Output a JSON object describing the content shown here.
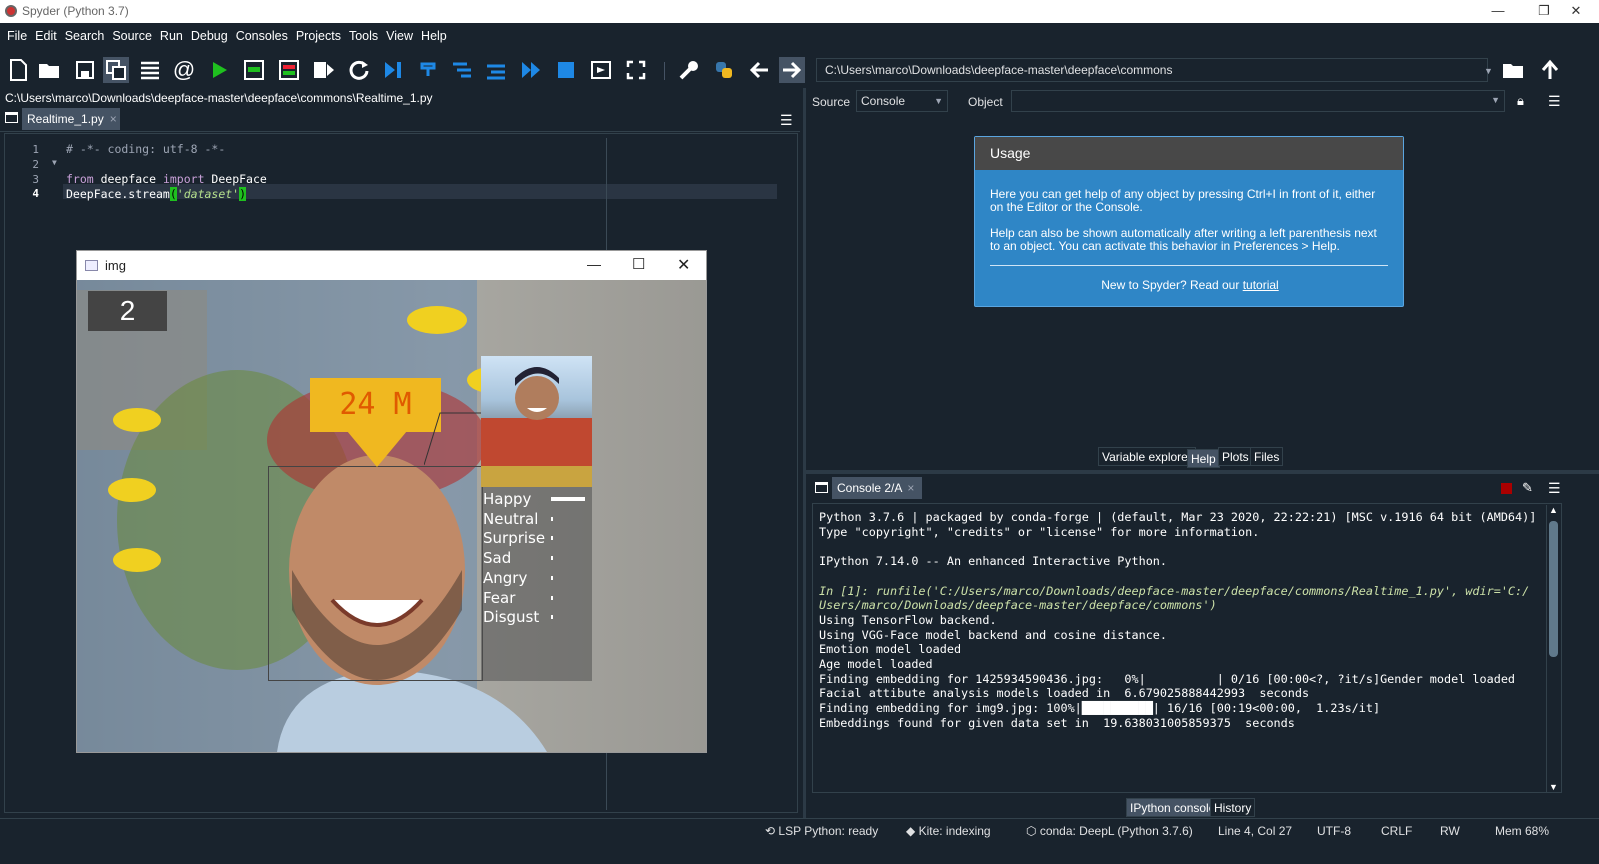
{
  "window": {
    "title": "Spyder (Python 3.7)",
    "min": "—",
    "max": "❐",
    "close": "✕"
  },
  "menu": [
    "File",
    "Edit",
    "Search",
    "Source",
    "Run",
    "Debug",
    "Consoles",
    "Projects",
    "Tools",
    "View",
    "Help"
  ],
  "toolbar": {
    "path": "C:\\Users\\marco\\Downloads\\deepface-master\\deepface\\commons"
  },
  "editor": {
    "filepath": "C:\\Users\\marco\\Downloads\\deepface-master\\deepface\\commons\\Realtime_1.py",
    "tab": "Realtime_1.py",
    "tab_close": "×",
    "line_numbers": [
      "1",
      "2",
      "3",
      "4"
    ],
    "lines": {
      "l1": "# -*- coding: utf-8 -*-",
      "l3_kw1": "from",
      "l3_mod": " deepface ",
      "l3_kw2": "import",
      "l3_cls": " DeepFace",
      "l4_call": "DeepFace.stream",
      "l4_po": "(",
      "l4_arg": "'dataset'",
      "l4_pc": ")"
    }
  },
  "img_window": {
    "title": "img",
    "min": "—",
    "max": "☐",
    "close": "✕",
    "counter": "2",
    "age_gender": "24 M",
    "emotions": [
      {
        "label": "Happy",
        "score": 1.0
      },
      {
        "label": "Neutral",
        "score": 0.02
      },
      {
        "label": "Surprise",
        "score": 0.02
      },
      {
        "label": "Sad",
        "score": 0.02
      },
      {
        "label": "Angry",
        "score": 0.02
      },
      {
        "label": "Fear",
        "score": 0.02
      },
      {
        "label": "Disgust",
        "score": 0.02
      }
    ]
  },
  "help": {
    "source_label": "Source",
    "source_value": "Console",
    "object_label": "Object",
    "usage_title": "Usage",
    "p1": "Here you can get help of any object by pressing Ctrl+I in front of it, either on the Editor or the Console.",
    "p2": "Help can also be shown automatically after writing a left parenthesis next to an object. You can activate this behavior in Preferences > Help.",
    "p3a": "New to Spyder? Read our ",
    "p3link": "tutorial",
    "tabs": [
      "Variable explorer",
      "Help",
      "Plots",
      "Files"
    ]
  },
  "console": {
    "tab": "Console 2/A",
    "tab_close": "×",
    "lines": [
      "Python 3.7.6 | packaged by conda-forge | (default, Mar 23 2020, 22:22:21) [MSC v.1916 64 bit (AMD64)]",
      "Type \"copyright\", \"credits\" or \"license\" for more information.",
      "",
      "IPython 7.14.0 -- An enhanced Interactive Python.",
      "",
      "In [1]: runfile('C:/Users/marco/Downloads/deepface-master/deepface/commons/Realtime_1.py', wdir='C:/",
      "Users/marco/Downloads/deepface-master/deepface/commons')",
      "Using TensorFlow backend.",
      "Using VGG-Face model backend and cosine distance.",
      "Emotion model loaded",
      "Age model loaded",
      "Finding embedding for 1425934590436.jpg:   0%|          | 0/16 [00:00<?, ?it/s]Gender model loaded",
      "Facial attibute analysis models loaded in  6.679025888442993  seconds",
      "Finding embedding for img9.jpg: 100%|██████████| 16/16 [00:19<00:00,  1.23s/it]",
      "Embeddings found for given data set in  19.638031005859375  seconds"
    ],
    "tabs": [
      "IPython console",
      "History"
    ]
  },
  "status": {
    "lsp": "LSP Python: ready",
    "kite": "Kite: indexing",
    "conda": "conda: DeepL (Python 3.7.6)",
    "pos": "Line 4, Col 27",
    "enc": "UTF-8",
    "eol": "CRLF",
    "rw": "RW",
    "mem": "Mem 68%"
  },
  "colors": {
    "bg": "#19232d",
    "accent": "#2f86c6",
    "green": "#1fc01f",
    "yellow": "#f0b820"
  }
}
